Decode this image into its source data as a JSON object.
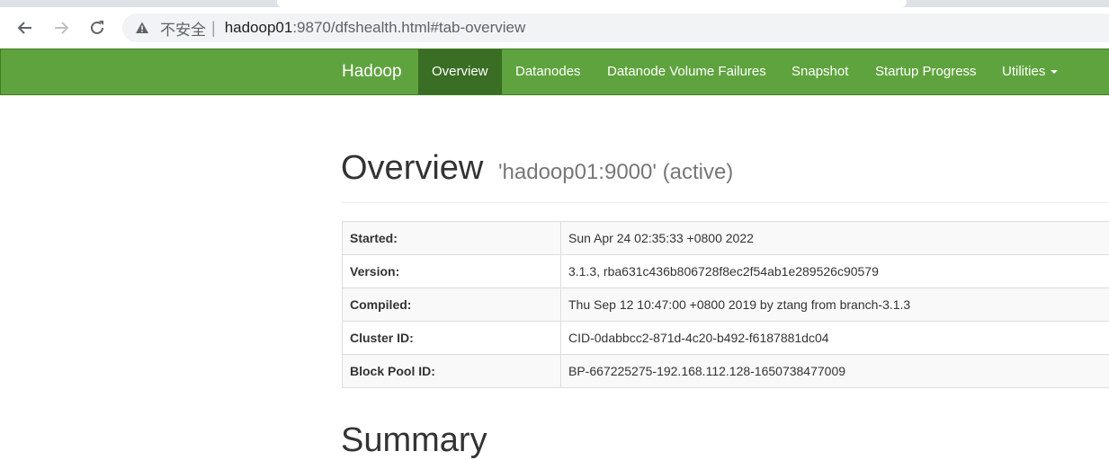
{
  "browser": {
    "insecure_label": "不安全",
    "separator": "|",
    "url_host": "hadoop01",
    "url_rest": ":9870/dfshealth.html#tab-overview"
  },
  "navbar": {
    "brand": "Hadoop",
    "items": [
      {
        "label": "Overview",
        "active": true
      },
      {
        "label": "Datanodes"
      },
      {
        "label": "Datanode Volume Failures"
      },
      {
        "label": "Snapshot"
      },
      {
        "label": "Startup Progress"
      },
      {
        "label": "Utilities",
        "dropdown": true
      }
    ]
  },
  "overview": {
    "title": "Overview",
    "subtitle": "'hadoop01:9000' (active)",
    "rows": [
      {
        "key": "Started:",
        "value": "Sun Apr 24 02:35:33 +0800 2022"
      },
      {
        "key": "Version:",
        "value": "3.1.3, rba631c436b806728f8ec2f54ab1e289526c90579"
      },
      {
        "key": "Compiled:",
        "value": "Thu Sep 12 10:47:00 +0800 2019 by ztang from branch-3.1.3"
      },
      {
        "key": "Cluster ID:",
        "value": "CID-0dabbcc2-871d-4c20-b492-f6187881dc04"
      },
      {
        "key": "Block Pool ID:",
        "value": "BP-667225275-192.168.112.128-1650738477009"
      }
    ]
  },
  "summary": {
    "title": "Summary"
  },
  "icons": {
    "back": "back-arrow-icon",
    "forward": "forward-arrow-icon",
    "reload": "reload-icon",
    "warning": "warning-icon",
    "caret": "caret-down-icon"
  },
  "colors": {
    "navbar": "#5fa33e",
    "navbar_active": "#3a6e24"
  }
}
